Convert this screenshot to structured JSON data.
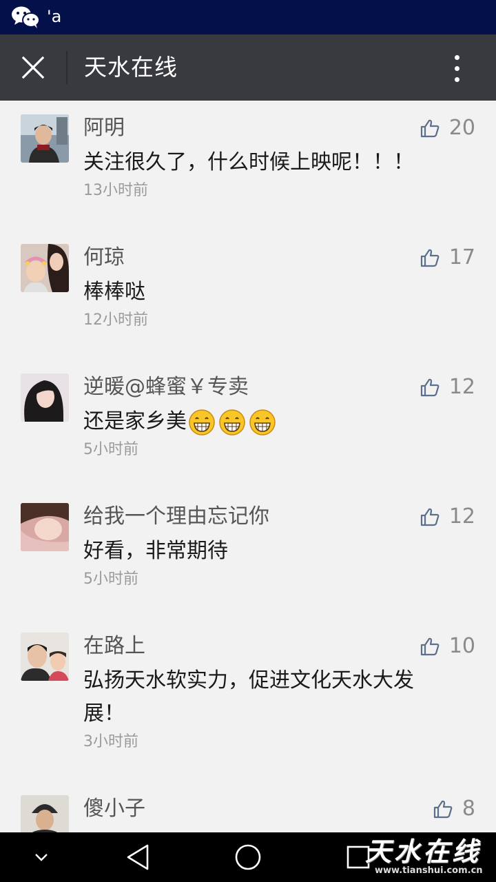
{
  "status_bar": {
    "text": "'a",
    "icon": "wechat-icon"
  },
  "header": {
    "title": "天水在线",
    "close_icon": "close-icon",
    "more_icon": "more-vertical-icon"
  },
  "comments": [
    {
      "author": "阿明",
      "likes": "20",
      "text": "关注很久了，什么时候上映呢！！！",
      "time": "13小时前"
    },
    {
      "author": "何琼",
      "likes": "17",
      "text": "棒棒哒",
      "time": "12小时前"
    },
    {
      "author": "逆暖@蜂蜜￥专卖",
      "likes": "12",
      "text": "还是家乡美",
      "emoji_count": 3,
      "emoji": "grinning-face-icon",
      "time": "5小时前"
    },
    {
      "author": "给我一个理由忘记你",
      "likes": "12",
      "text": "好看，非常期待",
      "time": "5小时前"
    },
    {
      "author": "在路上",
      "likes": "10",
      "text": "弘扬天水软实力，促进文化天水大发展！",
      "time": "3小时前"
    },
    {
      "author": "傻小子",
      "likes": "8",
      "text": "",
      "time": ""
    }
  ],
  "nav": {
    "down": "chevron-down-icon",
    "back": "back-triangle-icon",
    "home": "home-circle-icon",
    "recent": "recent-square-icon"
  },
  "watermark": {
    "text": "天水在线",
    "url": "www.tianshui.com.cn"
  },
  "colors": {
    "status_bar": "#04104a",
    "title_bar": "#393a3f",
    "background": "#f2f2f2",
    "like_icon": "#5b6e8c"
  }
}
